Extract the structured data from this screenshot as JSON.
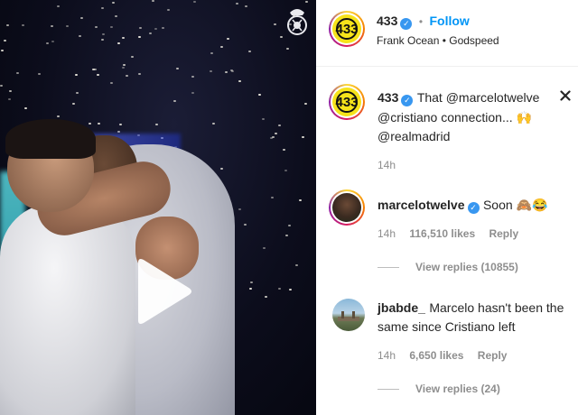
{
  "post": {
    "account": "433",
    "follow_label": "Follow",
    "separator": "•",
    "audio": "Frank Ocean • Godspeed",
    "caption": {
      "username": "433",
      "line1": "That @marcelotwelve",
      "line2": "@cristiano connection... 🙌",
      "line3": "@realmadrid",
      "time": "14h"
    }
  },
  "comments": [
    {
      "username": "marcelotwelve",
      "text": "Soon 🙈😂",
      "time": "14h",
      "likes": "116,510 likes",
      "reply_label": "Reply",
      "view_replies": "View replies (10855)"
    },
    {
      "username": "jbabde_",
      "text_line1": "Marcelo hasn't been the",
      "text_line2": "same since Cristiano left",
      "time": "14h",
      "likes": "6,650 likes",
      "reply_label": "Reply",
      "view_replies": "View replies (24)"
    }
  ],
  "colors": {
    "link": "#0095f6",
    "verified": "#3897f0",
    "meta_gray": "#8e8e8e",
    "logo_yellow": "#f6e31b"
  },
  "icons": [
    "play-icon",
    "real-madrid-crest-icon",
    "verified-badge-icon",
    "close-icon"
  ]
}
